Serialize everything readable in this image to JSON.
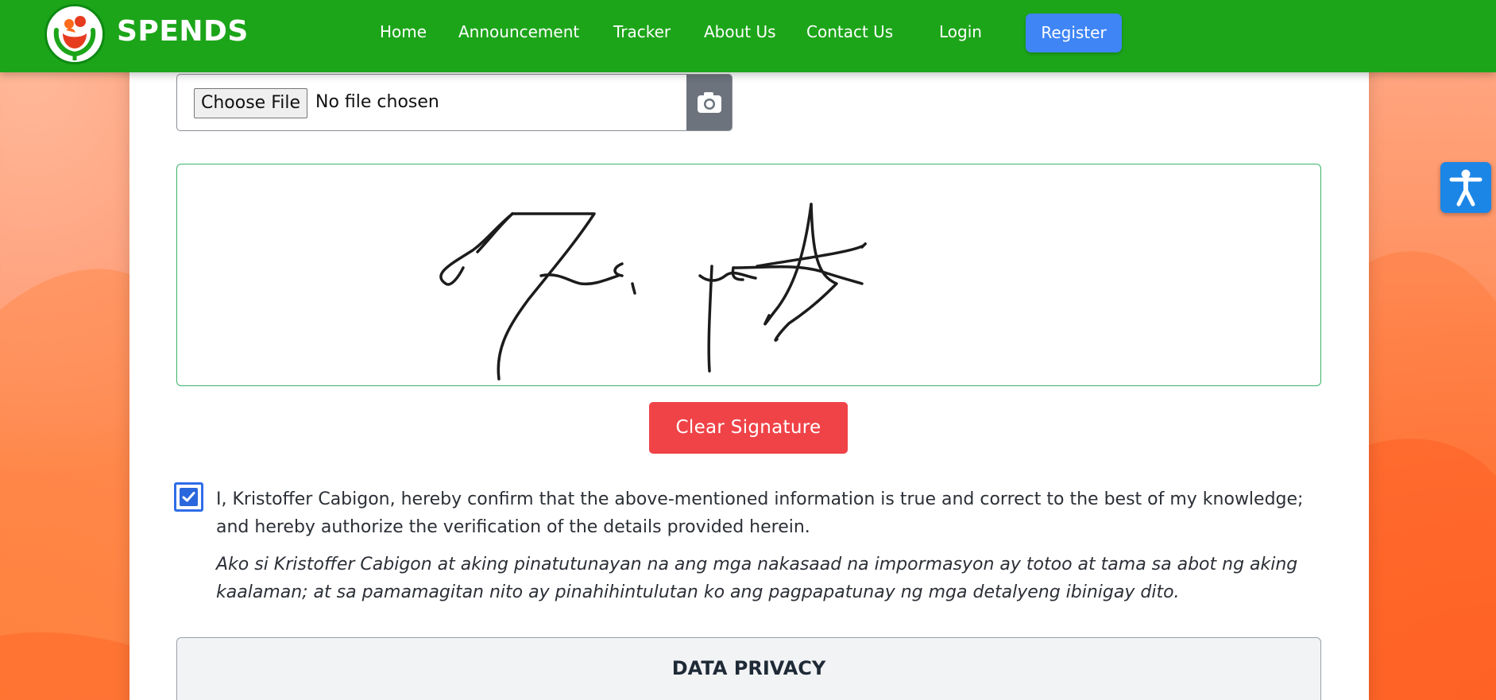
{
  "brand": {
    "name": "SPENDS",
    "logo_icon": "hands-holding-family-logo"
  },
  "nav": {
    "links": [
      "Home",
      "Announcement",
      "Tracker",
      "About Us",
      "Contact Us",
      "Login"
    ],
    "register_label": "Register"
  },
  "upload": {
    "button_label": "Choose File",
    "status": "No file chosen",
    "addon_icon": "camera-icon"
  },
  "signature": {
    "clear_label": "Clear Signature"
  },
  "consent": {
    "checked": true,
    "text_en": "I, Kristoffer Cabigon, hereby confirm that the above-mentioned information is true and correct to the best of my knowledge; and hereby authorize the verification of the details provided herein.",
    "text_tl": "Ako si Kristoffer Cabigon at aking pinatutunayan na ang mga nakasaad na impormasyon ay totoo at tama sa abot ng aking kaalaman; at sa pamamagitan nito ay pinahihintulutan ko ang pagpapatunay ng mga detalyeng ibinigay dito."
  },
  "privacy": {
    "title": "DATA PRIVACY"
  },
  "accessibility": {
    "icon": "accessibility-person-icon"
  },
  "colors": {
    "nav_bg": "#1da51a",
    "register_bg": "#3f85f5",
    "clear_bg": "#ef4348",
    "checkbox": "#2a67dc",
    "accessibility_bg": "#1c86e6",
    "signature_border": "#3bb36a"
  }
}
